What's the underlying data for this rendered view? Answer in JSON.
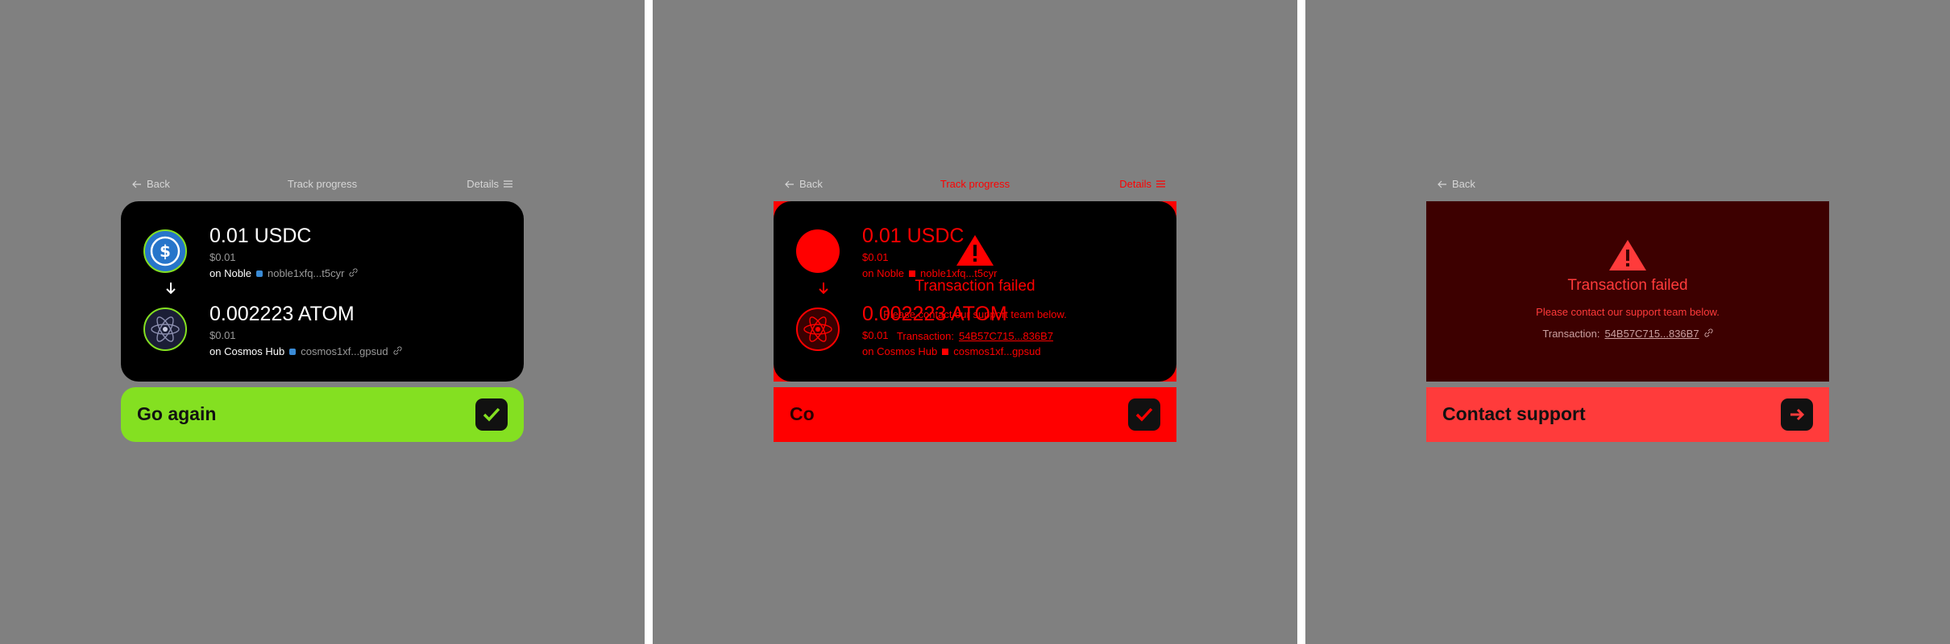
{
  "header": {
    "back_label": "Back",
    "title": "Track progress",
    "details_label": "Details"
  },
  "source": {
    "amount": "0.01 USDC",
    "usd": "$0.01",
    "chain": "on Noble",
    "address": "noble1xfq...t5cyr"
  },
  "destination": {
    "amount": "0.002223 ATOM",
    "usd": "$0.01",
    "chain": "on Cosmos Hub",
    "address": "cosmos1xf...gpsud"
  },
  "success_button": {
    "label": "Go again"
  },
  "failure": {
    "title": "Transaction failed",
    "message": "Please contact our support team below.",
    "tx_label": "Transaction:",
    "tx_hash": "54B57C715...836B7"
  },
  "glitch_button": {
    "label": "Co"
  },
  "support_button": {
    "label": "Contact support"
  },
  "colors": {
    "background": "#808080",
    "card": "#000000",
    "success": "#84e021",
    "error": "#ff0000",
    "error_soft": "#ff3b3b",
    "error_dark": "#3d0000"
  },
  "icons": {
    "source_token": "usdc-icon",
    "destination_token": "atom-icon",
    "flow": "arrow-down-icon",
    "success_badge": "checkmark-icon",
    "support_badge": "arrow-right-icon",
    "warning": "warning-triangle-icon"
  }
}
